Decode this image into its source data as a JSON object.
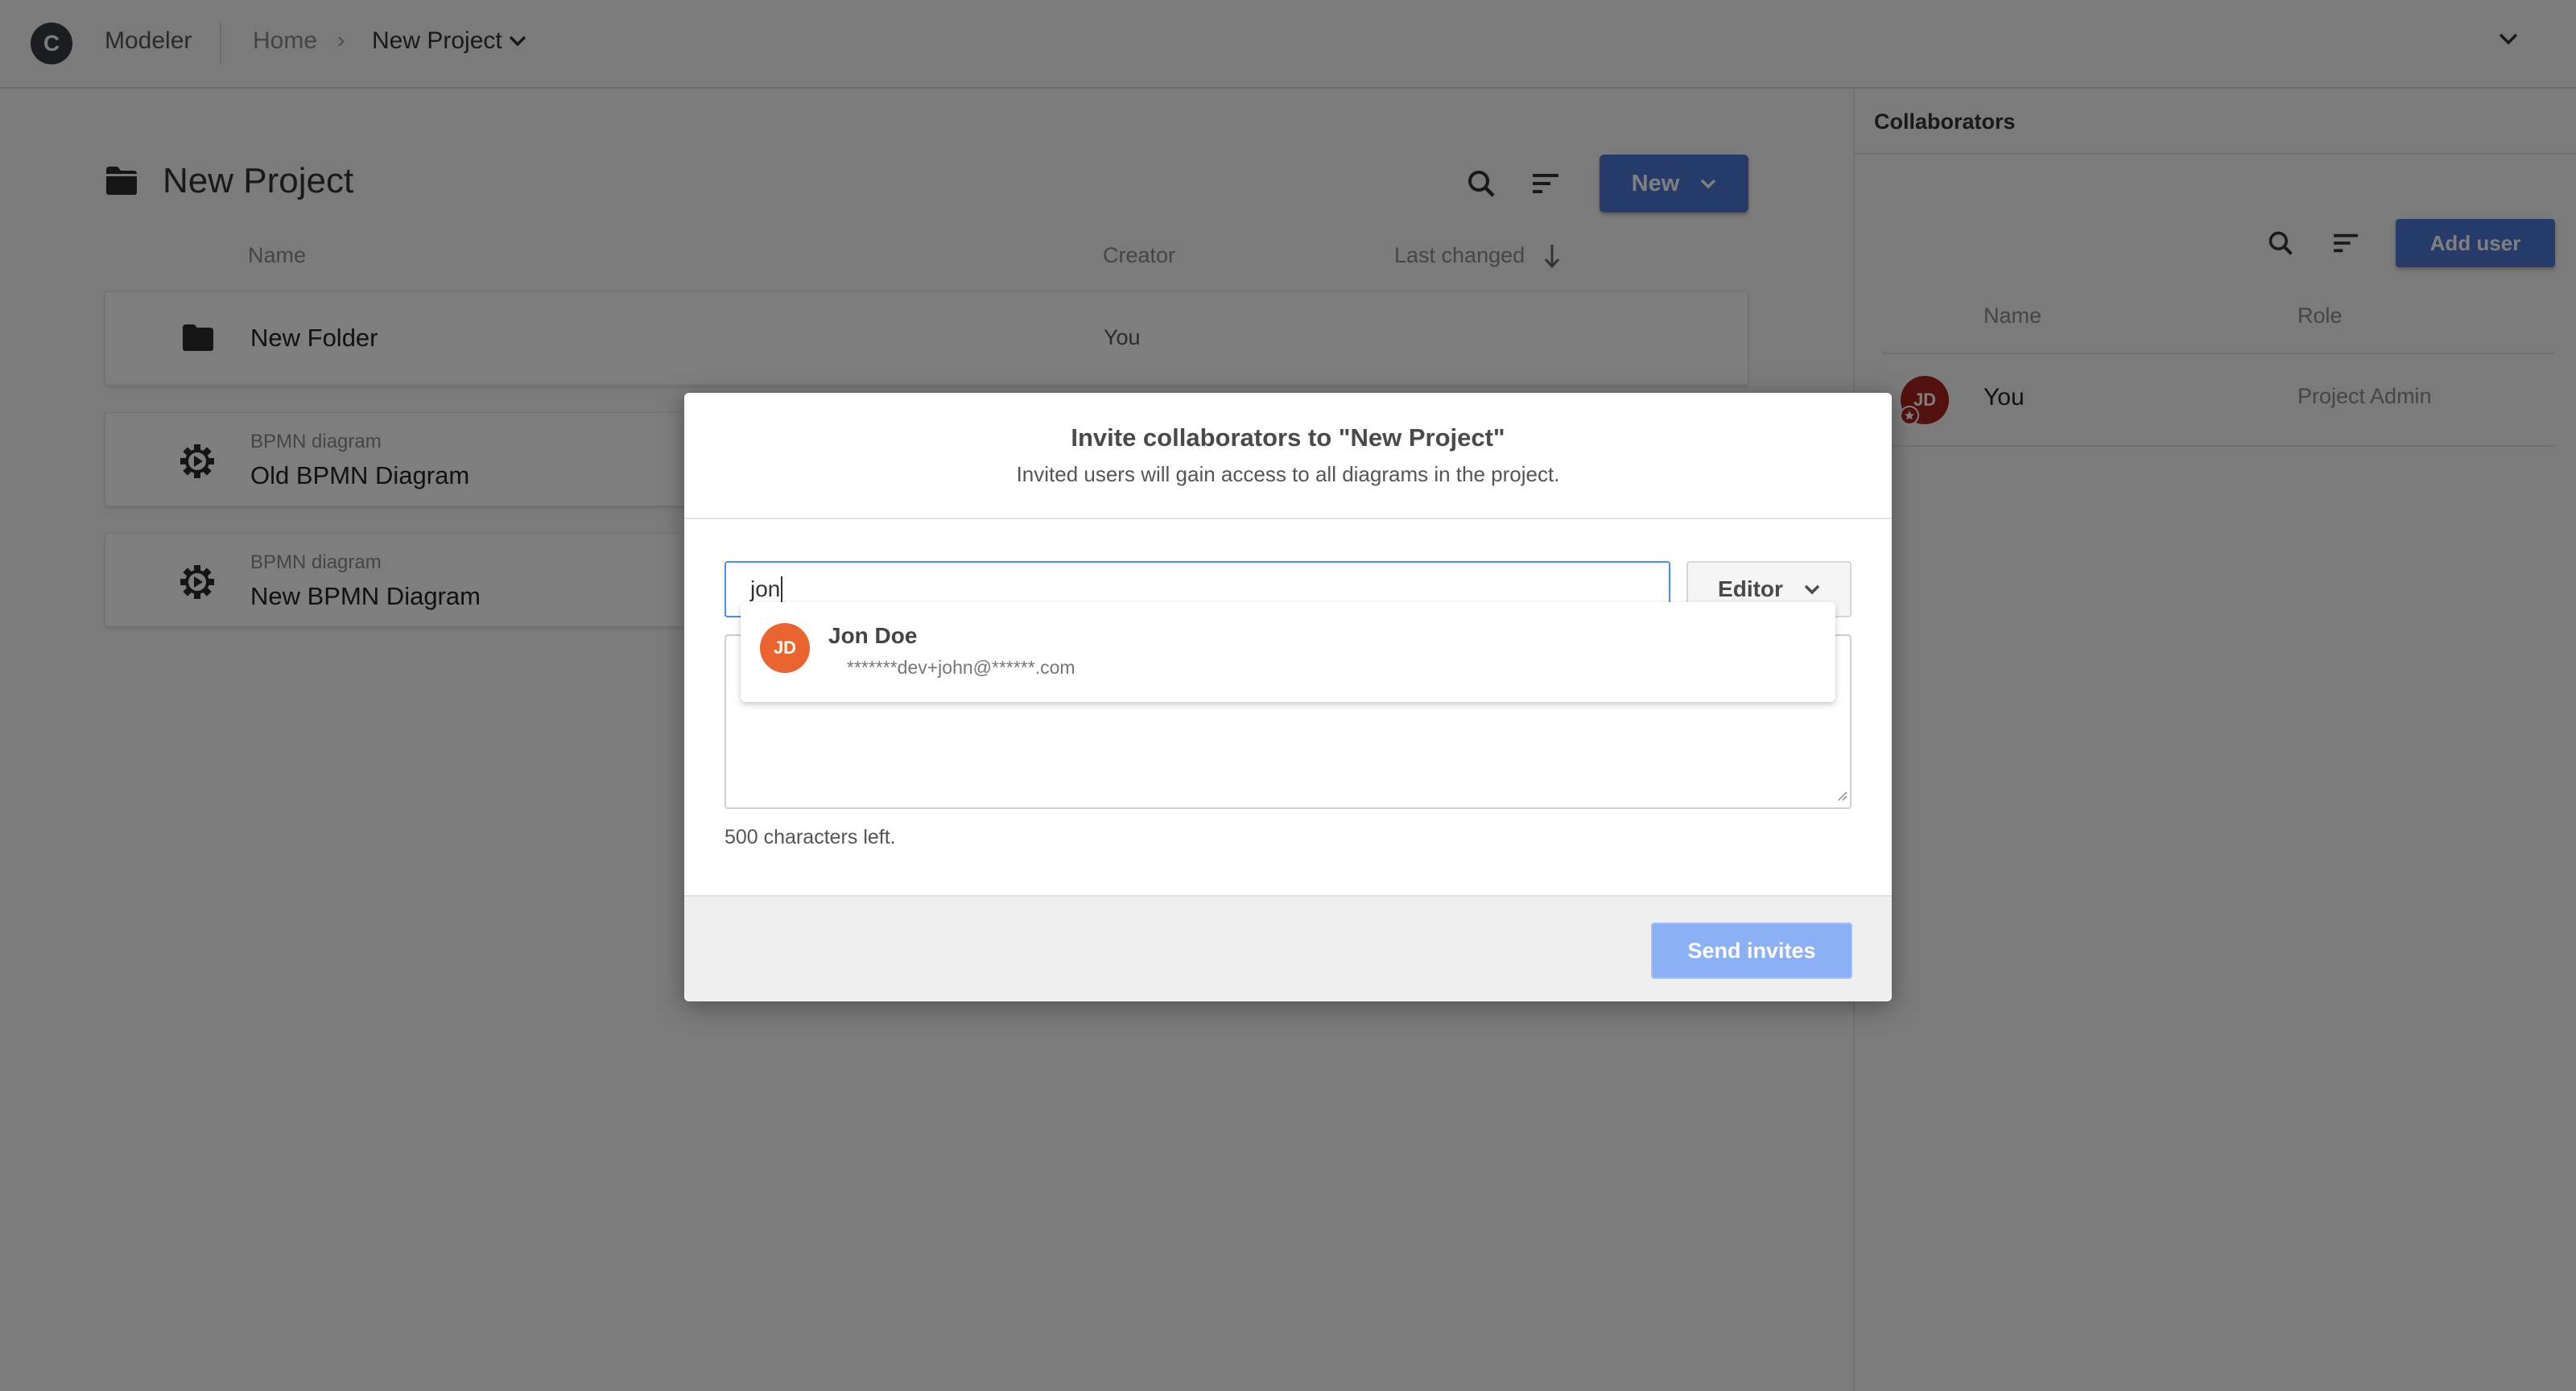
{
  "header": {
    "logo_letter": "C",
    "app_name": "Modeler",
    "breadcrumb": {
      "home": "Home",
      "separator": "›",
      "current": "New Project"
    }
  },
  "project": {
    "title": "New Project",
    "new_button_label": "New",
    "columns": {
      "name": "Name",
      "creator": "Creator",
      "last_changed": "Last changed"
    },
    "items": [
      {
        "kind": "folder",
        "type_label": "",
        "name": "New Folder",
        "creator": "You"
      },
      {
        "kind": "bpmn",
        "type_label": "BPMN diagram",
        "name": "Old BPMN Diagram",
        "creator": ""
      },
      {
        "kind": "bpmn",
        "type_label": "BPMN diagram",
        "name": "New BPMN Diagram",
        "creator": ""
      }
    ]
  },
  "collaborators": {
    "title": "Collaborators",
    "add_user_label": "Add user",
    "columns": {
      "name": "Name",
      "role": "Role"
    },
    "rows": [
      {
        "initials": "JD",
        "name": "You",
        "role": "Project Admin"
      }
    ]
  },
  "modal": {
    "title": "Invite collaborators to \"New Project\"",
    "subtitle": "Invited users will gain access to all diagrams in the project.",
    "input_value": "jon",
    "role_value": "Editor",
    "message_value": "",
    "chars_left": "500 characters left.",
    "send_label": "Send invites",
    "suggestions": [
      {
        "initials": "JD",
        "name": "Jon Doe",
        "email": "*******dev+john@******.com"
      }
    ]
  },
  "colors": {
    "primary": "#4d76d2",
    "primary_disabled": "#8cb0f6",
    "suggestion_avatar": "#ea6430",
    "owner_avatar": "#a5221f",
    "focus_border": "#4d8cf0"
  }
}
